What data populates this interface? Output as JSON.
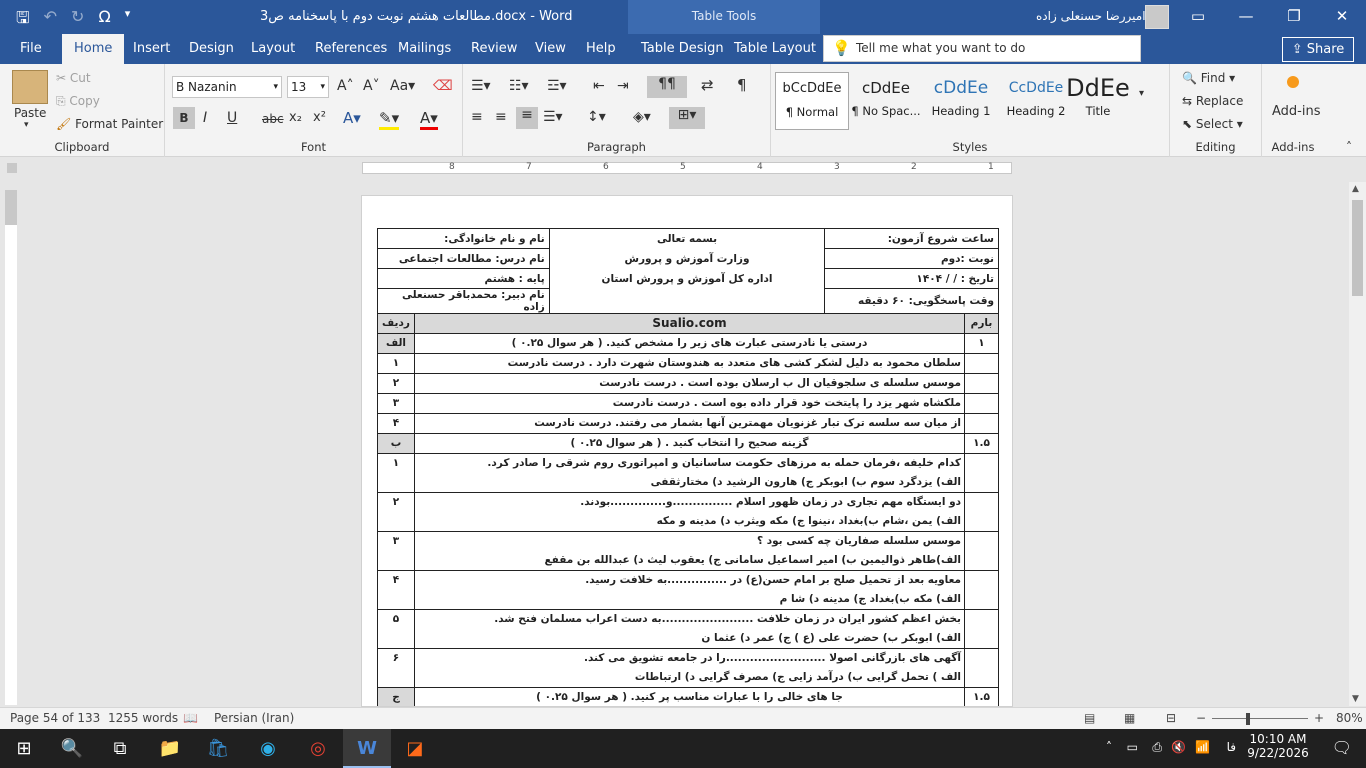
{
  "window": {
    "title": "مطالعات هشتم نوبت دوم با پاسخنامه ص3.docx  -  Word",
    "context_tab_group": "Table Tools",
    "user_name": "امیررضا حسنعلی زاده"
  },
  "qat": {
    "save": "save-icon",
    "undo": "undo-icon",
    "redo": "redo-icon",
    "symbol": "Ω"
  },
  "ribbon_tabs": [
    "File",
    "Home",
    "Insert",
    "Design",
    "Layout",
    "References",
    "Mailings",
    "Review",
    "View",
    "Help",
    "Table Design",
    "Table Layout"
  ],
  "active_tab": "Home",
  "tell_me": {
    "placeholder": "Tell me what you want to do"
  },
  "share_label": "Share",
  "clipboard": {
    "paste": "Paste",
    "cut": "Cut",
    "copy": "Copy",
    "format_painter": "Format Painter",
    "label": "Clipboard"
  },
  "font": {
    "name": "B Nazanin",
    "size": "13",
    "label": "Font",
    "bold": "B",
    "italic": "I",
    "underline": "U",
    "strike": "abc",
    "sub": "x₂",
    "sup": "x²"
  },
  "paragraph": {
    "label": "Paragraph"
  },
  "styles": {
    "items": [
      {
        "preview": "bCcDdEe",
        "name": "¶ Normal"
      },
      {
        "preview": "¶ No Spac...",
        "name": "¶ No Spac..."
      },
      {
        "preview": "cDdEe",
        "name": "Heading 1"
      },
      {
        "preview": "CcDdEe",
        "name": "Heading 2"
      },
      {
        "preview": "DdEe",
        "name": "Title"
      }
    ],
    "previews": [
      "bCcDdEe",
      "cDdEe",
      "cDdEe",
      "CcDdEe",
      "DdEe"
    ],
    "label": "Styles"
  },
  "editing": {
    "find": "Find",
    "replace": "Replace",
    "select": "Select",
    "label": "Editing"
  },
  "addins": {
    "label": "Add-ins",
    "group_label": "Add-ins"
  },
  "ruler": {
    "numbers": [
      "8",
      "7",
      "6",
      "5",
      "4",
      "3",
      "2",
      "1"
    ]
  },
  "doc": {
    "header_rows": [
      {
        "right": "نام و نام خانوادگی:",
        "center": "بسمه تعالی",
        "left": "ساعت شروع آزمون:"
      },
      {
        "right": "نام درس: مطالعات اجتماعی",
        "center": "وزارت آموزش و پرورش",
        "left": "نوبت :دوم"
      },
      {
        "right": "پایه : هشتم",
        "center": "اداره کل آموزش و پرورش استان",
        "left": "تاریخ :      /    /   ۱۴۰۴"
      },
      {
        "right": "نام دبیر: محمدباقر حسنعلی زاده",
        "center": "",
        "left": "وقت پاسخگویی: ۶۰ دقیقه"
      }
    ],
    "col_headers": {
      "num": "ردیف",
      "brand": "Sualio.com",
      "mark": "بارم"
    },
    "sections": [
      {
        "letter": "الف",
        "title": "درستی یا نادرستی عبارت های زیر را مشخص کنید. ( هر سوال ۰.۲۵ )",
        "mark": "۱",
        "items": [
          {
            "n": "۱",
            "text": "سلطان محمود به دلیل لشکر کشی های متعدد به هندوستان شهرت دارد . درست    نادرست"
          },
          {
            "n": "۲",
            "text": "موسس سلسله ی سلجوقیان ال ب ارسلان بوده است . درست    نادرست"
          },
          {
            "n": "۳",
            "text": "ملکشاه شهر یزد را پایتخت خود قرار داده بوه است . درست    نادرست"
          },
          {
            "n": "۴",
            "text": "از میان سه سلسه ترک تبار غزنویان مهمترین آنها بشمار می رفتند. درست    نادرست"
          }
        ]
      },
      {
        "letter": "ب",
        "title": "گزینه صحیح را انتخاب کنید . ( هر سوال ۰.۲۵ )",
        "mark": "۱.۵",
        "items": [
          {
            "n": "۱",
            "text": "کدام خلیفه ،فرمان حمله به مرزهای حکومت ساسانیان و امپراتوری روم شرقی را صادر کرد.",
            "opts": "الف) یزدگرد سوم    ب) ابوبکر    ج) هارون الرشید    د) مختارثقفی"
          },
          {
            "n": "۲",
            "text": "دو ایستگاه مهم تجاری در زمان ظهور اسلام ...............و..............بودند.",
            "opts": "الف) یمن ،شام    ب)بغداد ،نینوا    ج) مکه ویثرب    د) مدینه و مکه"
          },
          {
            "n": "۳",
            "text": "موسس سلسله صفاریان چه کسی بود ؟",
            "opts": "الف)طاهر ذوالیمین    ب) امیر اسماعیل سامانی    ج) یعقوب لیث    د) عبدالله بن مقفع"
          },
          {
            "n": "۴",
            "text": "معاویه بعد از تحمیل صلح بر امام حسن(ع) در ...............به خلافت رسید.",
            "opts": "الف) مکه    ب)بغداد    ج) مدینه    د) شا م"
          },
          {
            "n": "۵",
            "text": "بخش اعظم کشور ایران در زمان خلافت .......................به دست اعراب مسلمان فتح شد.",
            "opts": "الف) ابوبکر    ب) حضرت علی (ع )    ج) عمر    د) عثما ن"
          },
          {
            "n": "۶",
            "text": "آگهی های بازرگانی اصولا .........................را در جامعه تشویق می کند.",
            "opts": "الف ) تحمل گرایی    ب) درآمد زایی    ج) مصرف گرایی    د) ارتباطات"
          }
        ]
      },
      {
        "letter": "ج",
        "title": "جا های خالی را با عبارات مناسب پر کنید. ( هر سوال ۰.۲۵ )",
        "mark": "۱.۵",
        "items": []
      }
    ]
  },
  "status": {
    "page": "Page 54 of 133",
    "words": "1255 words",
    "language": "Persian (Iran)",
    "zoom": "80%"
  },
  "taskbar": {
    "time": "10:10 AM",
    "date": "9/22/2026",
    "lang": "فا"
  }
}
